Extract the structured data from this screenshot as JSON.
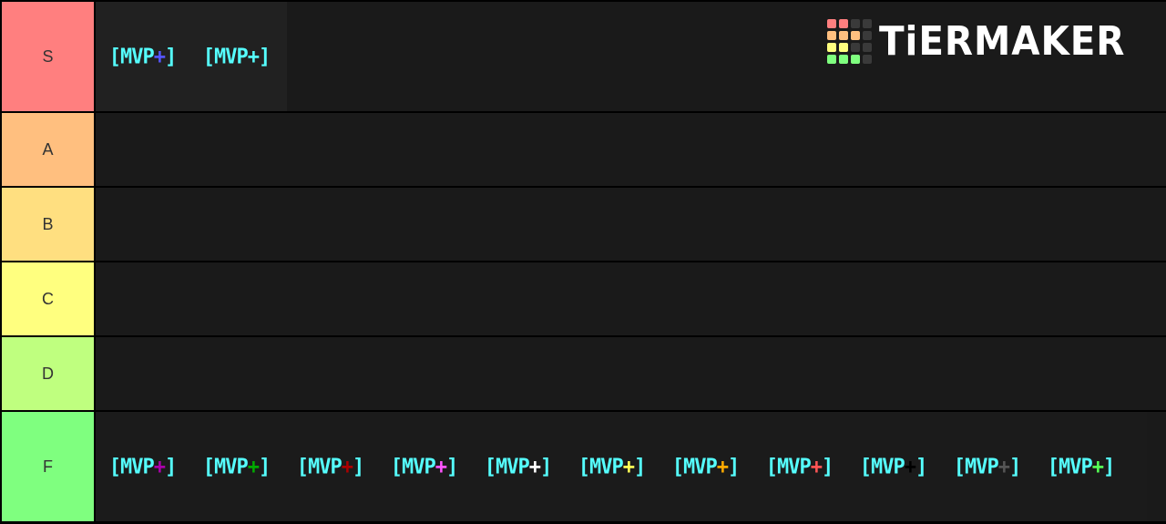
{
  "logo": {
    "text": "TiERMAKER",
    "grid_colors": [
      "#ff7f7f",
      "#ff7f7f",
      "#3a3a3a",
      "#3a3a3a",
      "#ffbf7f",
      "#ffbf7f",
      "#ffbf7f",
      "#3a3a3a",
      "#ffff7f",
      "#ffff7f",
      "#3a3a3a",
      "#3a3a3a",
      "#7fff7f",
      "#7fff7f",
      "#7fff7f",
      "#3a3a3a"
    ]
  },
  "tiers": [
    {
      "label": "S",
      "color": "#ff7f7f"
    },
    {
      "label": "A",
      "color": "#ffbf7f"
    },
    {
      "label": "B",
      "color": "#ffdf80"
    },
    {
      "label": "C",
      "color": "#ffff7f"
    },
    {
      "label": "D",
      "color": "#bfff7f"
    },
    {
      "label": "F",
      "color": "#7fff7f"
    }
  ],
  "tag": {
    "open": "[MVP",
    "plus": "+",
    "close": "]",
    "base_color": "#55ffff"
  },
  "s_items": [
    {
      "plus_color": "#5555ff"
    },
    {
      "plus_color": "#55ffff"
    }
  ],
  "f_items": [
    {
      "plus_color": "#aa00aa"
    },
    {
      "plus_color": "#00aa00"
    },
    {
      "plus_color": "#aa0000"
    },
    {
      "plus_color": "#ff55ff"
    },
    {
      "plus_color": "#ffffff"
    },
    {
      "plus_color": "#ffff55"
    },
    {
      "plus_color": "#ffaa00"
    },
    {
      "plus_color": "#ff5555"
    },
    {
      "plus_color": "#000000"
    },
    {
      "plus_color": "#555555"
    },
    {
      "plus_color": "#55ff55"
    }
  ]
}
